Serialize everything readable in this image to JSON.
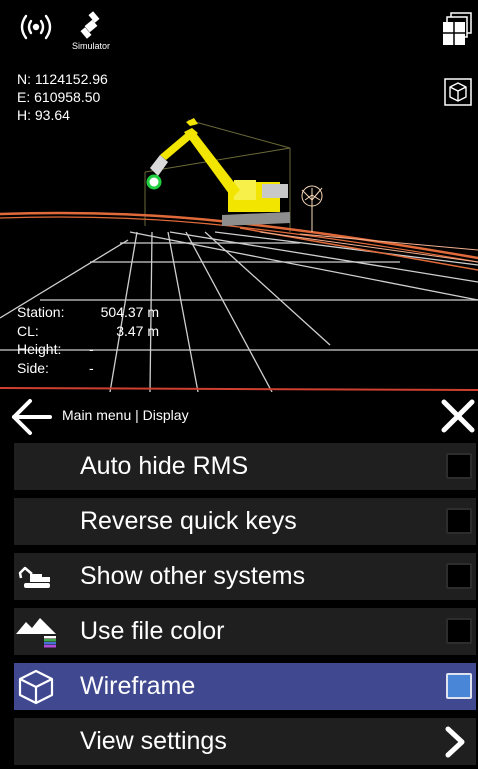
{
  "status": {
    "simulator_label": "Simulator"
  },
  "coords": {
    "north": "N: 1124152.96",
    "east": "E: 610958.50",
    "height": "H: 93.64"
  },
  "station_info": {
    "station_key": "Station:",
    "station_val": "504.37 m",
    "cl_key": "CL:",
    "cl_val": "3.47 m",
    "height_key": "Height:",
    "height_val": "-",
    "side_key": "Side:",
    "side_val": "-"
  },
  "menu": {
    "breadcrumb": "Main menu | Display",
    "items": [
      {
        "label": "Auto hide RMS",
        "checked": false
      },
      {
        "label": "Reverse quick keys",
        "checked": false
      },
      {
        "label": "Show other systems",
        "checked": false,
        "icon": "excavator-icon"
      },
      {
        "label": "Use file color",
        "checked": false,
        "icon": "terrain-color-icon"
      },
      {
        "label": "Wireframe",
        "checked": true,
        "icon": "wireframe-cube-icon"
      },
      {
        "label": "View settings",
        "icon": "chevron-right-icon"
      }
    ]
  },
  "colors": {
    "active_item": "#40498f",
    "item_bg": "#1f1f1f",
    "checkbox_checked": "#4a86d8",
    "machine": "#f2e600",
    "road_line": "#e06a3a"
  }
}
